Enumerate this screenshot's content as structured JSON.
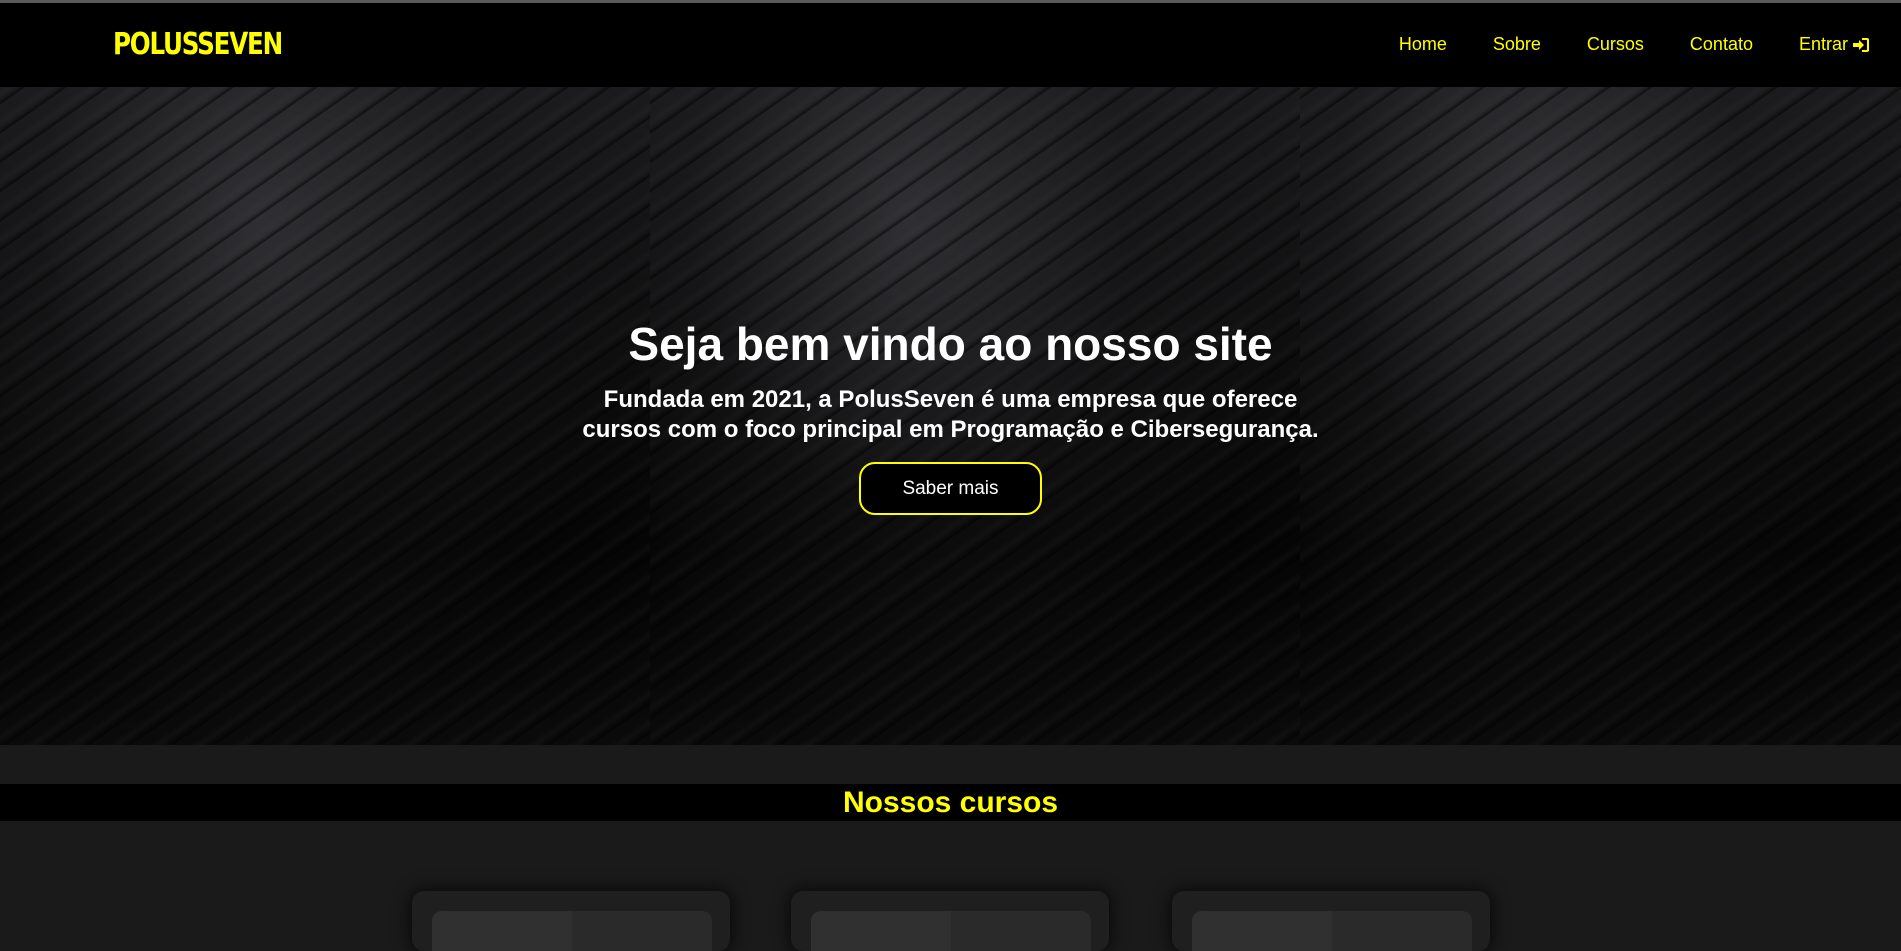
{
  "header": {
    "logo": "POLUSSEVEN",
    "nav": [
      {
        "label": "Home"
      },
      {
        "label": "Sobre"
      },
      {
        "label": "Cursos"
      },
      {
        "label": "Contato"
      },
      {
        "label": "Entrar",
        "icon": "sign-in-icon"
      }
    ]
  },
  "hero": {
    "title": "Seja bem vindo ao nosso site",
    "subtitle_line1": "Fundada em 2021, a PolusSeven é uma empresa que oferece",
    "subtitle_line2": "cursos com o foco principal em Programação e Cibersegurança.",
    "button_label": "Saber mais"
  },
  "courses": {
    "title": "Nossos cursos",
    "cards_count_visible": 3
  },
  "colors": {
    "accent": "#ffff00",
    "background": "#1a1a1a",
    "header": "#000000"
  }
}
